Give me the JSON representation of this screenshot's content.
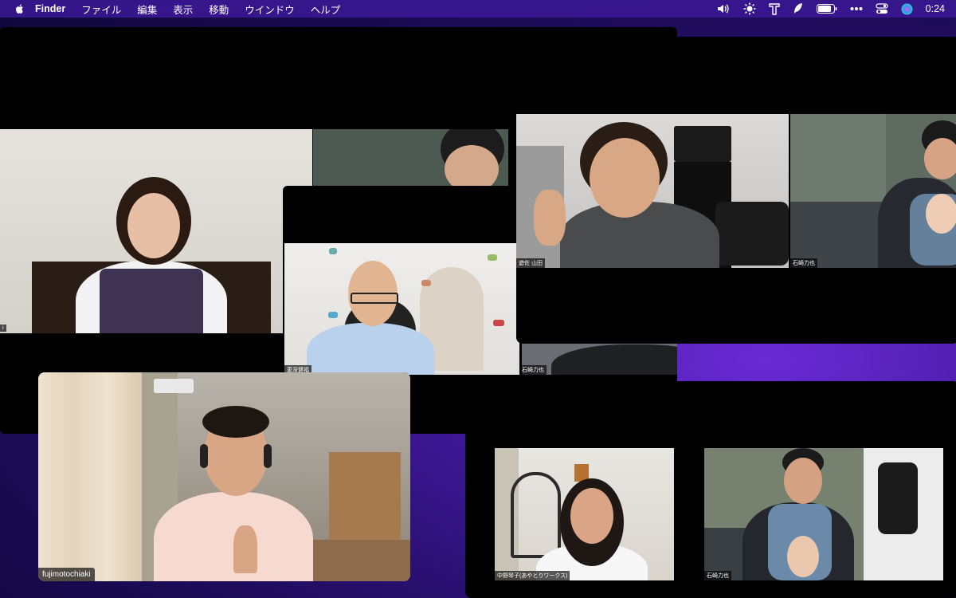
{
  "menubar": {
    "app_name": "Finder",
    "menus": [
      "ファイル",
      "編集",
      "表示",
      "移動",
      "ウインドウ",
      "ヘルプ"
    ],
    "clock": "0:24",
    "status_icons": [
      "volume-icon",
      "brightness-icon",
      "text-icon",
      "feather-icon",
      "battery-icon",
      "more-icon",
      "control-center-icon",
      "siri-icon"
    ]
  },
  "participants": {
    "p1": "i",
    "p2": "",
    "p3": "恵深健福",
    "p4": "石崎力也",
    "p5": "fujimotochiaki",
    "p6": "遊佐 山田",
    "p7": "石崎力也",
    "p8": "中野琴子(あやとりワークス)",
    "p9": "石崎力也"
  },
  "colors": {
    "menubar": "#3c1996",
    "window": "#000000"
  }
}
